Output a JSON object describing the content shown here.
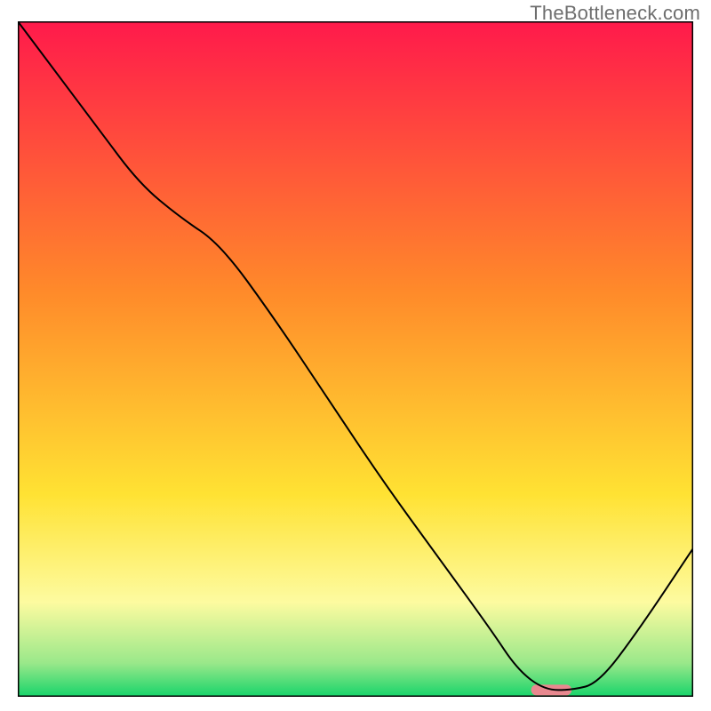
{
  "watermark": "TheBottleneck.com",
  "chart_data": {
    "type": "line",
    "title": "",
    "xlabel": "",
    "ylabel": "",
    "xlim": [
      0,
      100
    ],
    "ylim": [
      0,
      100
    ],
    "grid": false,
    "legend": false,
    "gradient": {
      "stops": [
        {
          "offset": 0.0,
          "color": "#ff1a4b"
        },
        {
          "offset": 0.4,
          "color": "#ff8a2a"
        },
        {
          "offset": 0.7,
          "color": "#ffe233"
        },
        {
          "offset": 0.86,
          "color": "#fdfba0"
        },
        {
          "offset": 0.95,
          "color": "#9ae88a"
        },
        {
          "offset": 1.0,
          "color": "#16d46a"
        }
      ]
    },
    "series": [
      {
        "name": "bottleneck-curve",
        "color": "#000000",
        "width": 2,
        "x": [
          0,
          6,
          12,
          18,
          24,
          30,
          38,
          46,
          54,
          62,
          70,
          74,
          78,
          82,
          86,
          92,
          100
        ],
        "y": [
          100,
          92,
          84,
          76,
          71,
          67,
          56,
          44,
          32,
          21,
          10,
          4,
          1,
          1,
          2,
          10,
          22
        ]
      }
    ],
    "marker": {
      "name": "optimal-range",
      "x_start": 76,
      "x_end": 82,
      "y": 1,
      "color": "#e8888f",
      "thickness": 12
    }
  }
}
